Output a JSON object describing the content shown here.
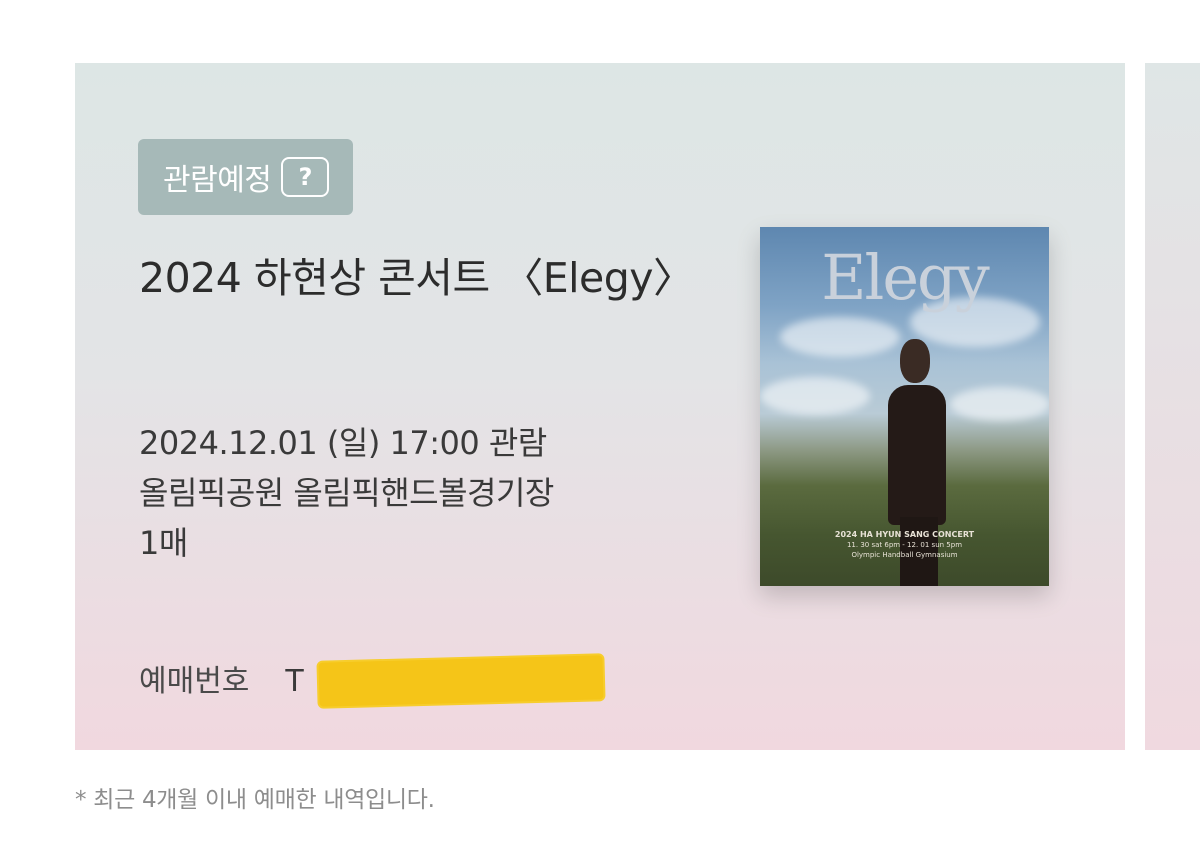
{
  "ticket": {
    "status_label": "관람예정",
    "help_symbol": "?",
    "title": "2024 하현상 콘서트 〈Elegy〉",
    "date_time": "2024.12.01 (일)  17:00 관람",
    "venue": "올림픽공원 올림픽핸드볼경기장",
    "quantity": "1매",
    "booking_number_label": "예매번호",
    "booking_number_value": "T",
    "poster": {
      "title": "Elegy",
      "caption_main": "2024 HA HYUN SANG CONCERT",
      "caption_dates": "11. 30 sat 6pm - 12. 01 sun 5pm",
      "caption_venue": "Olympic Handball Gymnasium"
    }
  },
  "footnote": "* 최근 4개월 이내 예매한 내역입니다.",
  "colors": {
    "badge_bg": "#a6b9b8",
    "redaction": "#f5c518"
  }
}
